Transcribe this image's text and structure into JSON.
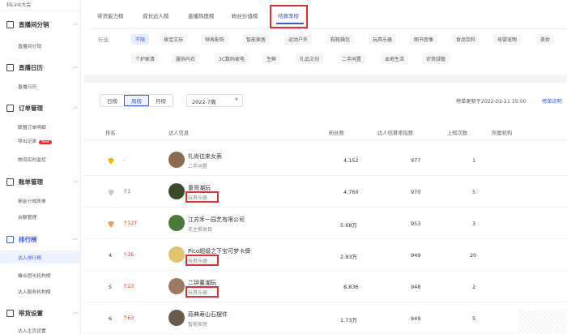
{
  "sidebar": {
    "top_text": "抖Link大会",
    "sections": [
      {
        "title": "直播间分销",
        "items": [
          "直播间分销"
        ]
      },
      {
        "title": "直播日历",
        "items": [
          "直播日历"
        ]
      },
      {
        "title": "订单管理",
        "items": [
          "联盟订单明细",
          "导出记录",
          "物流实时监控"
        ],
        "new_badge": "New"
      },
      {
        "title": "账单管理",
        "items": [
          "佣金分成账单",
          "余额管理"
        ]
      },
      {
        "title": "排行榜",
        "items": [
          "达人排行榜",
          "撮合团长机构榜",
          "达人服务机构榜"
        ]
      },
      {
        "title": "带货设置",
        "items": [
          "达人主页设置"
        ]
      }
    ]
  },
  "tabs": [
    "带货能力榜",
    "成长达人榜",
    "直播热度榜",
    "粉丝价值榜",
    "结算率榜"
  ],
  "filter": {
    "label": "行业",
    "row1": [
      "不限",
      "珠宝文玩",
      "钟表配饰",
      "智能家居",
      "运动户外",
      "鞋靴箱包",
      "玩具乐器",
      "图书音像",
      "食品饮料",
      "母婴宠物",
      "美妆"
    ],
    "row2": [
      "个护家清",
      "服饰内衣",
      "3C数码家电",
      "生鲜",
      "礼品文创",
      "二手闲置",
      "本地生活",
      "农资绿植"
    ]
  },
  "controls": {
    "seg": [
      "日榜",
      "周榜",
      "月榜"
    ],
    "date": "2022-7周",
    "updated": "榜单更新于2022-02-21 15:00",
    "link": "榜单说明"
  },
  "table": {
    "headers": [
      "排名",
      "达人信息",
      "粉丝数",
      "达人结算率指数",
      "上榜次数",
      "所属机构"
    ],
    "rows": [
      {
        "rank": "",
        "change": "-",
        "name": "礼尚往来女表",
        "cat": "二手闲置",
        "fans": "4,152",
        "index": "977",
        "times": "1"
      },
      {
        "rank": "",
        "change": "↑1",
        "name": "童哥潮玩",
        "cat": "玩具乐器",
        "fans": "4,760",
        "index": "970",
        "times": "5"
      },
      {
        "rank": "",
        "change": "↑127",
        "name": "江苏禾一园艺有限公司",
        "cat": "无主推类目",
        "fans": "5.68万",
        "index": "953",
        "times": "3"
      },
      {
        "rank": "4",
        "change": "↑35",
        "name": "Pico超级之下宝可梦卡牌",
        "cat": "玩具乐器",
        "fans": "2.83万",
        "index": "949",
        "times": "20"
      },
      {
        "rank": "5",
        "change": "↑23",
        "name": "二钟董潮玩",
        "cat": "玩具乐器",
        "fans": "8,836",
        "index": "948",
        "times": "2"
      },
      {
        "rank": "6",
        "change": "↑63",
        "name": "蒜典寿山石摆件",
        "cat": "智能家居",
        "fans": "1.73万",
        "index": "949",
        "times": "5"
      }
    ]
  }
}
